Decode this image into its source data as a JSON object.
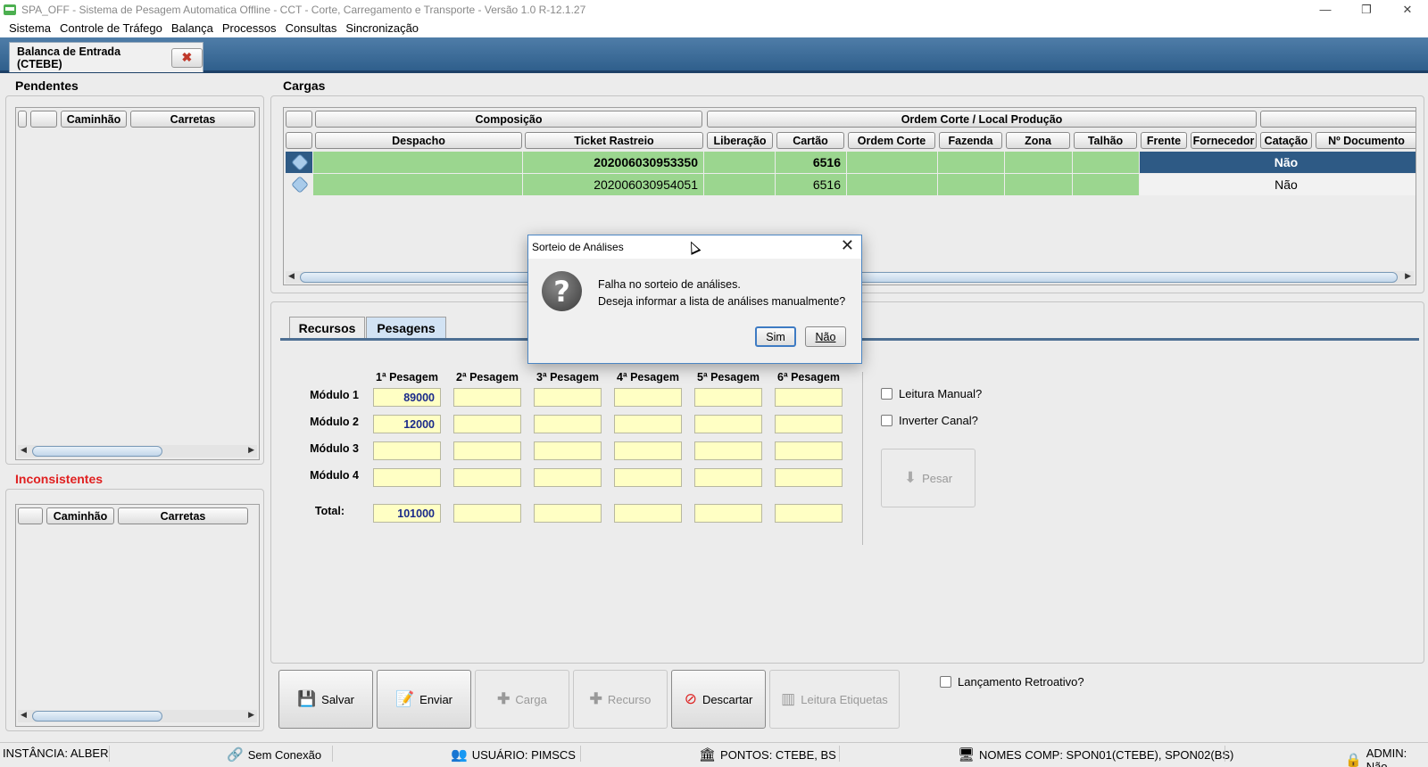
{
  "window": {
    "title": "SPA_OFF - Sistema de Pesagem Automatica Offline - CCT - Corte, Carregamento e Transporte - Versão 1.0 R-12.1.27",
    "controls": [
      "—",
      "❐",
      "✕"
    ]
  },
  "menu": [
    "Sistema",
    "Controle de Tráfego",
    "Balança",
    "Processos",
    "Consultas",
    "Sincronização"
  ],
  "doc_tab": {
    "label": "Balanca de Entrada (CTEBE)",
    "close": "✖"
  },
  "pendentes": {
    "title": "Pendentes",
    "columns": [
      "",
      "Caminhão",
      "Carretas"
    ]
  },
  "inconsistentes": {
    "title": "Inconsistentes",
    "title_color": "#e02020",
    "columns": [
      "",
      "Caminhão",
      "Carretas"
    ]
  },
  "cargas": {
    "title": "Cargas",
    "group_headers": [
      "",
      "Composição",
      "Ordem Corte / Local Produção",
      ""
    ],
    "columns": [
      "",
      "Despacho",
      "Ticket Rastreio",
      "Liberação",
      "Cartão",
      "Ordem Corte",
      "Fazenda",
      "Zona",
      "Talhão",
      "Frente",
      "Fornecedor",
      "Catação",
      "Nº Documento"
    ],
    "rows": [
      {
        "ticket": "202006030953350",
        "cartao": "6516",
        "catacao": "Não",
        "selected": true
      },
      {
        "ticket": "202006030954051",
        "cartao": "6516",
        "catacao": "Não",
        "selected": false
      }
    ],
    "row_color": "#9bd68f",
    "selected_color": "#2e5a85"
  },
  "pesagens": {
    "tabs": [
      "Recursos",
      "Pesagens"
    ],
    "active_tab": "Pesagens",
    "columns": [
      "1ª Pesagem",
      "2ª Pesagem",
      "3ª Pesagem",
      "4ª Pesagem",
      "5ª Pesagem",
      "6ª Pesagem"
    ],
    "rows": [
      {
        "label": "Módulo 1",
        "values": [
          "89000",
          "",
          "",
          "",
          "",
          ""
        ]
      },
      {
        "label": "Módulo 2",
        "values": [
          "12000",
          "",
          "",
          "",
          "",
          ""
        ]
      },
      {
        "label": "Módulo 3",
        "values": [
          "",
          "",
          "",
          "",
          "",
          ""
        ]
      },
      {
        "label": "Módulo 4",
        "values": [
          "",
          "",
          "",
          "",
          "",
          ""
        ]
      }
    ],
    "total": {
      "label": "Total:",
      "values": [
        "101000",
        "",
        "",
        "",
        "",
        ""
      ]
    },
    "leitura_manual": "Leitura Manual?",
    "inverter_canal": "Inverter Canal?",
    "pesar": "Pesar"
  },
  "lancamento_retroativo": "Lançamento Retroativo?",
  "actions": [
    {
      "label": "Salvar",
      "icon": "save-icon",
      "enabled": true
    },
    {
      "label": "Enviar",
      "icon": "send-icon",
      "enabled": true
    },
    {
      "label": "Carga",
      "icon": "plus-icon",
      "enabled": false
    },
    {
      "label": "Recurso",
      "icon": "plus-icon",
      "enabled": false
    },
    {
      "label": "Descartar",
      "icon": "prohibited-icon",
      "enabled": true
    },
    {
      "label": "Leitura Etiquetas",
      "icon": "barcode-icon",
      "enabled": false
    }
  ],
  "status": {
    "instancia": "INSTÂNCIA: ALBER",
    "conexao": "Sem Conexão",
    "usuario": "USUÁRIO: PIMSCS",
    "pontos": "PONTOS: CTEBE, BS",
    "nomes_comp": "NOMES COMP: SPON01(CTEBE), SPON02(BS)",
    "admin": "ADMIN: Não"
  },
  "dialog": {
    "title": "Sorteio de Análises",
    "line1": "Falha no sorteio de análises.",
    "line2": "Deseja informar a lista de análises manualmente?",
    "yes": "Sim",
    "no": "Não",
    "close": "✕",
    "icon": "?"
  }
}
